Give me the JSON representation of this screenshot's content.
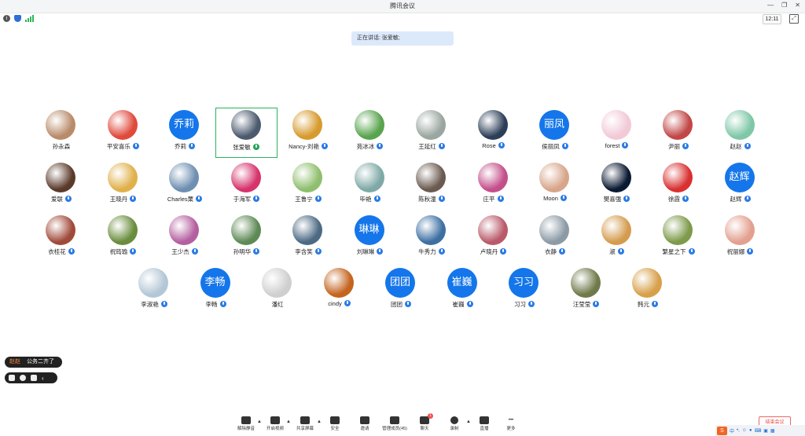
{
  "window": {
    "title": "腾讯会议",
    "time": "12:11"
  },
  "speaking": "正在讲话: 张爱敏;",
  "participants": [
    {
      "name": "孙永森",
      "avatar_color": "#b98b6a",
      "mic": "none"
    },
    {
      "name": "平安喜乐",
      "avatar_color": "#e04a3c",
      "mic": "muted"
    },
    {
      "name": "乔莉",
      "avatar_text": "乔莉",
      "mic": "muted"
    },
    {
      "name": "张爱敏",
      "avatar_color": "#4c5a6f",
      "mic": "speaking",
      "active": true
    },
    {
      "name": "Nancy-刘艳",
      "avatar_color": "#d79a2d",
      "mic": "muted"
    },
    {
      "name": "苑冰冰",
      "avatar_color": "#59a44f",
      "mic": "muted"
    },
    {
      "name": "王延红",
      "avatar_color": "#9aa6a0",
      "mic": "muted"
    },
    {
      "name": "Rose",
      "avatar_color": "#2c3e58",
      "mic": "muted"
    },
    {
      "name": "侯丽凤",
      "avatar_text": "丽凤",
      "mic": "muted"
    },
    {
      "name": "forest",
      "avatar_color": "#f2c9d6",
      "mic": "muted"
    },
    {
      "name": "尹丽",
      "avatar_color": "#c24747",
      "mic": "muted"
    },
    {
      "name": "赵赵",
      "avatar_color": "#7fc7a7",
      "mic": "muted"
    },
    {
      "name": "爱联",
      "avatar_color": "#5a3a2a",
      "mic": "muted"
    },
    {
      "name": "王晓丹",
      "avatar_color": "#e0b04b",
      "mic": "muted"
    },
    {
      "name": "Charles栗",
      "avatar_color": "#6f8fb1",
      "mic": "muted"
    },
    {
      "name": "于海军",
      "avatar_color": "#d6336c",
      "mic": "muted"
    },
    {
      "name": "王鲁宁",
      "avatar_color": "#8fbf6e",
      "mic": "muted"
    },
    {
      "name": "毕艳",
      "avatar_color": "#7fa9a6",
      "mic": "muted"
    },
    {
      "name": "陈秋潼",
      "avatar_color": "#6b5a4f",
      "mic": "muted"
    },
    {
      "name": "庄平",
      "avatar_color": "#c44f8a",
      "mic": "muted"
    },
    {
      "name": "Moon",
      "avatar_color": "#d8a58a",
      "mic": "muted"
    },
    {
      "name": "樊喜强",
      "avatar_color": "#0b1a33",
      "mic": "muted"
    },
    {
      "name": "徐霞",
      "avatar_color": "#d93030",
      "mic": "muted"
    },
    {
      "name": "赵辉",
      "avatar_text": "赵辉",
      "mic": "muted"
    },
    {
      "name": "衣桂花",
      "avatar_color": "#a04a3a",
      "mic": "muted"
    },
    {
      "name": "祝筠瑜",
      "avatar_color": "#6a8d3d",
      "mic": "muted"
    },
    {
      "name": "王少杰",
      "avatar_color": "#b45fa0",
      "mic": "muted"
    },
    {
      "name": "孙明华",
      "avatar_color": "#5e8a55",
      "mic": "muted"
    },
    {
      "name": "李含笑",
      "avatar_color": "#4d6a84",
      "mic": "muted"
    },
    {
      "name": "刘琳琳",
      "avatar_text": "琳琳",
      "mic": "muted"
    },
    {
      "name": "牛秀力",
      "avatar_color": "#3e6fa3",
      "mic": "muted"
    },
    {
      "name": "卢晓丹",
      "avatar_color": "#b95a6a",
      "mic": "muted"
    },
    {
      "name": "衣静",
      "avatar_color": "#8c9aa5",
      "mic": "muted"
    },
    {
      "name": "淑",
      "avatar_color": "#d49c4f",
      "mic": "muted"
    },
    {
      "name": "繁星之下",
      "avatar_color": "#7e9a4a",
      "mic": "muted"
    },
    {
      "name": "祝丽娜",
      "avatar_color": "#e3a08f",
      "mic": "muted"
    },
    {
      "name": "李淑艳",
      "avatar_color": "#b3c7d6",
      "mic": "muted"
    },
    {
      "name": "李畅",
      "avatar_text": "李畅",
      "mic": "muted"
    },
    {
      "name": "潘红",
      "avatar_color": "#cfcfcf",
      "mic": "none"
    },
    {
      "name": "cindy",
      "avatar_color": "#c4641f",
      "mic": "muted"
    },
    {
      "name": "团团",
      "avatar_text": "团团",
      "mic": "muted"
    },
    {
      "name": "崔巍",
      "avatar_text": "崔巍",
      "mic": "muted"
    },
    {
      "name": "习习",
      "avatar_text": "习习",
      "mic": "muted"
    },
    {
      "name": "汪莹莹",
      "avatar_color": "#6f7a4a",
      "mic": "muted"
    },
    {
      "name": "韩元",
      "avatar_color": "#d7a04a",
      "mic": "muted"
    }
  ],
  "chat": {
    "sender": "赵赵",
    "message": "公务二齐了"
  },
  "toolbar": [
    {
      "label": "解除静音",
      "icon": "mic-muted-icon"
    },
    {
      "label": "开启视频",
      "icon": "video-off-icon"
    },
    {
      "label": "共享屏幕",
      "icon": "share-screen-icon"
    },
    {
      "label": "安全",
      "icon": "shield-icon"
    },
    {
      "label": "邀请",
      "icon": "invite-icon"
    },
    {
      "label": "管理成员(45)",
      "icon": "members-icon"
    },
    {
      "label": "聊天",
      "icon": "chat-icon",
      "badge": "1"
    },
    {
      "label": "录制",
      "icon": "record-icon"
    },
    {
      "label": "直播",
      "icon": "live-icon"
    },
    {
      "label": "更多",
      "icon": "more-icon"
    }
  ],
  "end_button": "结束会议",
  "ime": {
    "logo": "S",
    "mode": "中"
  }
}
